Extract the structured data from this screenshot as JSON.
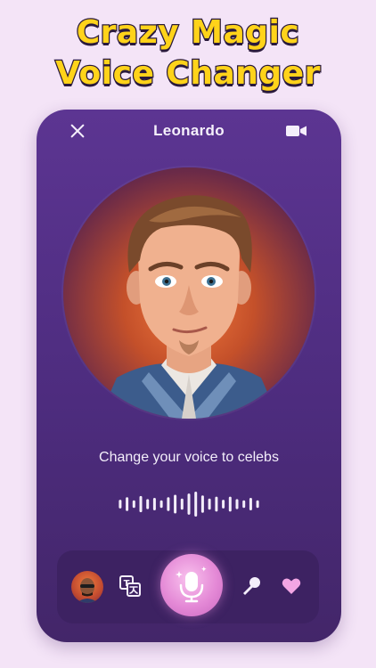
{
  "headline": {
    "line1": "Crazy Magic",
    "line2": "Voice Changer"
  },
  "call": {
    "title": "Leonardo",
    "subtitle": "Change your voice to celebs"
  },
  "icons": {
    "close": "close-icon",
    "video": "video-camera-icon",
    "translate": "translate-icon",
    "mic": "microphone-icon",
    "voice_mic": "handheld-microphone-icon",
    "favorite": "heart-icon"
  },
  "colors": {
    "background": "#f4e4f7",
    "card": "#5c3592",
    "dock": "#3d2262",
    "headline_fill": "#ffd31a",
    "headline_outline": "#2a1a3c",
    "mic_button": "#e489d6",
    "heart": "#f3a6e4"
  },
  "waveform": [
    0.35,
    0.55,
    0.3,
    0.65,
    0.4,
    0.5,
    0.3,
    0.55,
    0.75,
    0.45,
    0.85,
    1.0,
    0.7,
    0.45,
    0.6,
    0.35,
    0.6,
    0.4,
    0.3,
    0.5,
    0.3
  ]
}
